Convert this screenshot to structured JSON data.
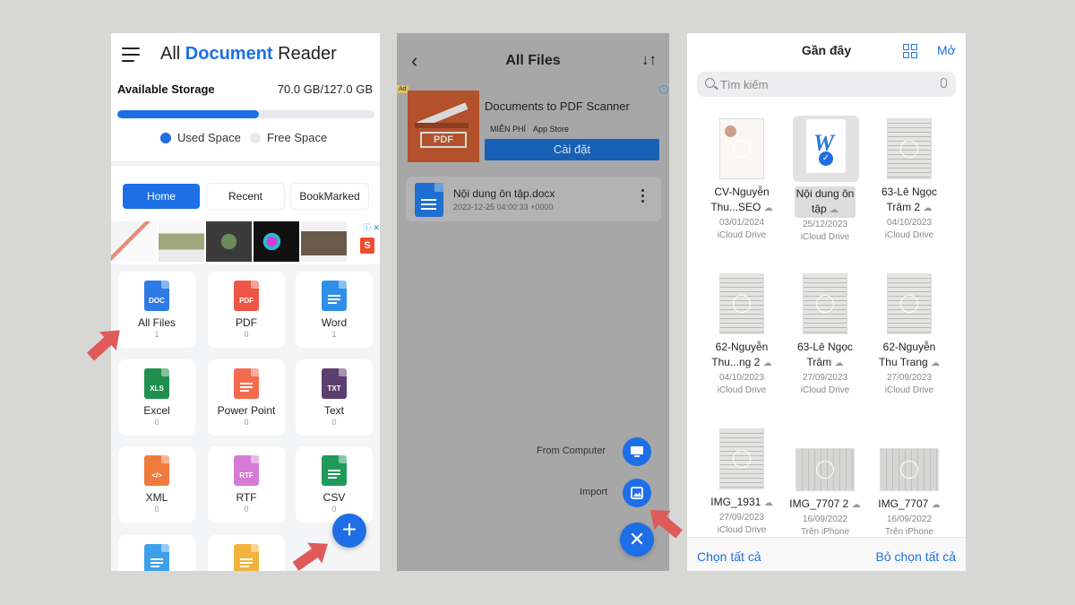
{
  "app": {
    "title_pre": "All ",
    "title_mid": "Document",
    "title_post": " Reader",
    "storage_label": "Available Storage",
    "storage_value": "70.0 GB/127.0 GB",
    "storage_used_fraction": 0.551,
    "legend": [
      "Used Space",
      "Free Space"
    ],
    "tabs": [
      "Home",
      "Recent",
      "BookMarked"
    ],
    "active_tab": "Home",
    "tiles": [
      {
        "label": "All Files",
        "count": "1",
        "icon_text": "DOC",
        "color": "#2f7be5",
        "icon": "doc-file-icon"
      },
      {
        "label": "PDF",
        "count": "0",
        "icon_text": "PDF",
        "color": "#ee5546",
        "icon": "pdf-file-icon"
      },
      {
        "label": "Word",
        "count": "1",
        "icon_text": "",
        "color": "#2f8fe8",
        "icon": "word-file-icon"
      },
      {
        "label": "Excel",
        "count": "0",
        "icon_text": "XLS",
        "color": "#1f8f4e",
        "icon": "excel-file-icon"
      },
      {
        "label": "Power Point",
        "count": "0",
        "icon_text": "",
        "color": "#f26b4f",
        "icon": "powerpoint-file-icon"
      },
      {
        "label": "Text",
        "count": "0",
        "icon_text": "TXT",
        "color": "#5b3f6e",
        "icon": "text-file-icon"
      },
      {
        "label": "XML",
        "count": "0",
        "icon_text": "</>",
        "color": "#ef7a3b",
        "icon": "xml-file-icon"
      },
      {
        "label": "RTF",
        "count": "0",
        "icon_text": "RTF",
        "color": "#d77ad6",
        "icon": "rtf-file-icon"
      },
      {
        "label": "CSV",
        "count": "0",
        "icon_text": "",
        "color": "#1e9a5a",
        "icon": "csv-file-icon"
      }
    ],
    "colors": {
      "accent": "#1e6fe6"
    }
  },
  "files": {
    "title": "All Files",
    "ad_title": "Documents to PDF Scanner",
    "ad_price": "MIỄN PHÍ",
    "ad_store": "App Store",
    "ad_button": "Cài đặt",
    "ad_badge": "Ad",
    "file_name": "Nội dung ôn tập.docx",
    "file_date": "2023-12-25 04:00:33 +0000",
    "fab_computer": "From Computer",
    "fab_import": "Import"
  },
  "picker": {
    "title": "Gần đây",
    "open_label": "Mở",
    "search_placeholder": "Tìm kiếm",
    "select_all": "Chọn tất cả",
    "deselect_all": "Bỏ chọn tất cả",
    "docs": [
      {
        "name1": "CV-Nguyễn",
        "name2": "Thu...SEO",
        "date": "03/01/2024",
        "loc": "iCloud Drive"
      },
      {
        "name1": "Nội dung ôn",
        "name2": "tập",
        "date": "25/12/2023",
        "loc": "iCloud Drive",
        "selected": true
      },
      {
        "name1": "63-Lê Ngọc",
        "name2": "Trâm 2",
        "date": "04/10/2023",
        "loc": "iCloud Drive"
      },
      {
        "name1": "62-Nguyễn",
        "name2": "Thu...ng 2",
        "date": "04/10/2023",
        "loc": "iCloud Drive"
      },
      {
        "name1": "63-Lê Ngọc",
        "name2": "Trâm",
        "date": "27/09/2023",
        "loc": "iCloud Drive"
      },
      {
        "name1": "62-Nguyễn",
        "name2": "Thu Trang",
        "date": "27/09/2023",
        "loc": "iCloud Drive"
      },
      {
        "name1": "IMG_1931",
        "name2": "",
        "date": "27/09/2023",
        "loc": "iCloud Drive"
      },
      {
        "name1": "IMG_7707 2",
        "name2": "",
        "date": "16/09/2022",
        "loc": "Trên iPhone"
      },
      {
        "name1": "IMG_7707",
        "name2": "",
        "date": "16/09/2022",
        "loc": "Trên iPhone"
      }
    ]
  }
}
